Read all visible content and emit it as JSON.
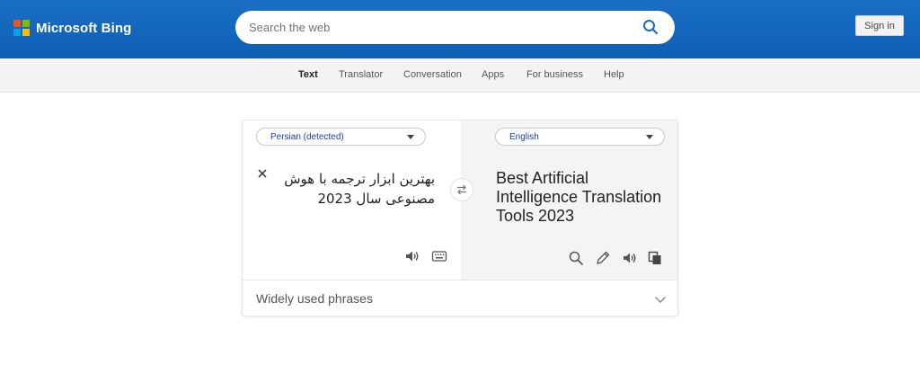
{
  "header": {
    "brand": "Microsoft Bing",
    "search_placeholder": "Search the web",
    "signin_label": "Sign in",
    "logo_colors": [
      "#f25022",
      "#7fba00",
      "#00a4ef",
      "#ffb900"
    ]
  },
  "nav": {
    "items": [
      {
        "label": "Text",
        "active": true
      },
      {
        "label": "Translator",
        "active": false
      },
      {
        "label": "Conversation",
        "active": false
      },
      {
        "label": "Apps",
        "active": false
      },
      {
        "label": "For business",
        "active": false
      },
      {
        "label": "Help",
        "active": false
      }
    ]
  },
  "translator": {
    "source_language": "Persian (detected)",
    "target_language": "English",
    "source_text": "بهترین ابزار ترجمه با هوش مصنوعی سال 2023",
    "target_text": "Best Artificial Intelligence Translation Tools 2023",
    "source_icons": [
      "close-icon",
      "speaker-icon",
      "keyboard-icon"
    ],
    "target_icons": [
      "search-icon",
      "pencil-icon",
      "speaker-icon",
      "copy-icon"
    ],
    "swap_icon": "swap-icon"
  },
  "phrases": {
    "label": "Widely used phrases",
    "icon": "chevron-down-icon"
  }
}
